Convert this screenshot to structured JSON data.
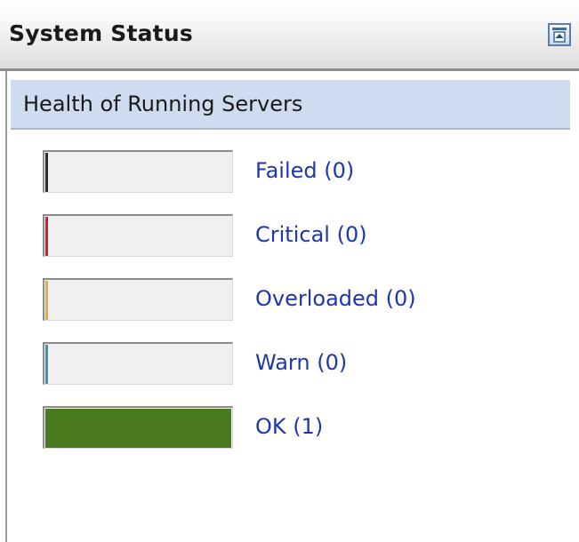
{
  "panel": {
    "title": "System Status",
    "restore_icon": "restore-window-icon"
  },
  "section": {
    "title": "Health of Running Servers"
  },
  "statuses": [
    {
      "label": "Failed",
      "count": "(0)",
      "fill_fraction": 0,
      "color": "#2b2b2b"
    },
    {
      "label": "Critical",
      "count": "(0)",
      "fill_fraction": 0,
      "color": "#d0202a"
    },
    {
      "label": "Overloaded",
      "count": "(0)",
      "fill_fraction": 0,
      "color": "#e0b030"
    },
    {
      "label": "Warn",
      "count": "(0)",
      "fill_fraction": 0,
      "color": "#3a95b5"
    },
    {
      "label": "OK",
      "count": "(1)",
      "fill_fraction": 1,
      "color": "#4a7a1e"
    }
  ],
  "colors": {
    "link": "#1f37a8",
    "subheader_bg": "#cfdcef"
  }
}
